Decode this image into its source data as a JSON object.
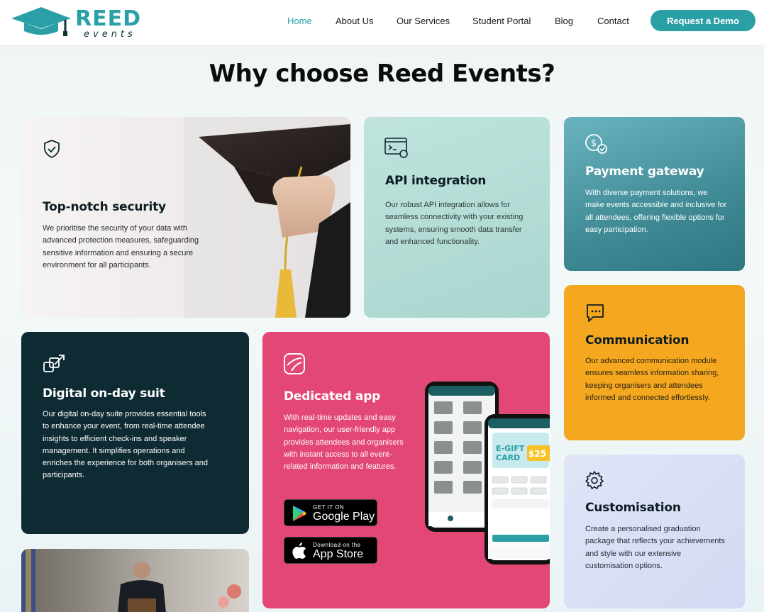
{
  "brand": {
    "name": "REED",
    "sub": "events"
  },
  "nav": {
    "items": [
      "Home",
      "About Us",
      "Our Services",
      "Student Portal",
      "Blog",
      "Contact"
    ],
    "active": "Home",
    "cta": "Request a Demo"
  },
  "title": "Why choose Reed Events?",
  "cards": {
    "security": {
      "title": "Top-notch security",
      "text": "We prioritise the security of your data with advanced protection measures, safeguarding sensitive information and ensuring a secure environment for all participants.",
      "icon": "shield-check-icon"
    },
    "api": {
      "title": "API integration",
      "text": "Our robust API integration allows for seamless connectivity with your existing systems, ensuring smooth data transfer and enhanced functionality.",
      "icon": "terminal-plug-icon"
    },
    "payment": {
      "title": "Payment gateway",
      "text": "With diverse payment solutions, we make events accessible and inclusive for all attendees, offering flexible options for easy participation.",
      "icon": "dollar-coin-check-icon"
    },
    "communication": {
      "title": "Communication",
      "text": "Our advanced communication module ensures seamless information sharing, keeping organisers and attendees informed and connected effortlessly.",
      "icon": "chat-bubble-icon"
    },
    "digital": {
      "title": "Digital on-day suit",
      "text": "Our digital on-day suite provides essential tools to enhance your event, from real-time attendee insights to efficient check-ins and speaker management. It simplifies operations and enriches the experience for both organisers and participants.",
      "icon": "expand-squares-icon"
    },
    "app": {
      "title": "Dedicated app",
      "text": "With real-time updates and easy navigation, our user-friendly app provides attendees and organisers with instant access to all event-related information and features.",
      "icon": "app-logo-icon",
      "google": {
        "small": "GET IT ON",
        "big": "Google Play"
      },
      "apple": {
        "small": "Download on the",
        "big": "App Store"
      }
    },
    "custom": {
      "title": "Customisation",
      "text": "Create a personalised graduation package that reflects your achievements and style with our extensive customisation options.",
      "icon": "gear-icon"
    }
  },
  "colors": {
    "accent": "#2aa0a6",
    "pink": "#e34775",
    "orange": "#f5a81f",
    "dark": "#0e2b33"
  }
}
